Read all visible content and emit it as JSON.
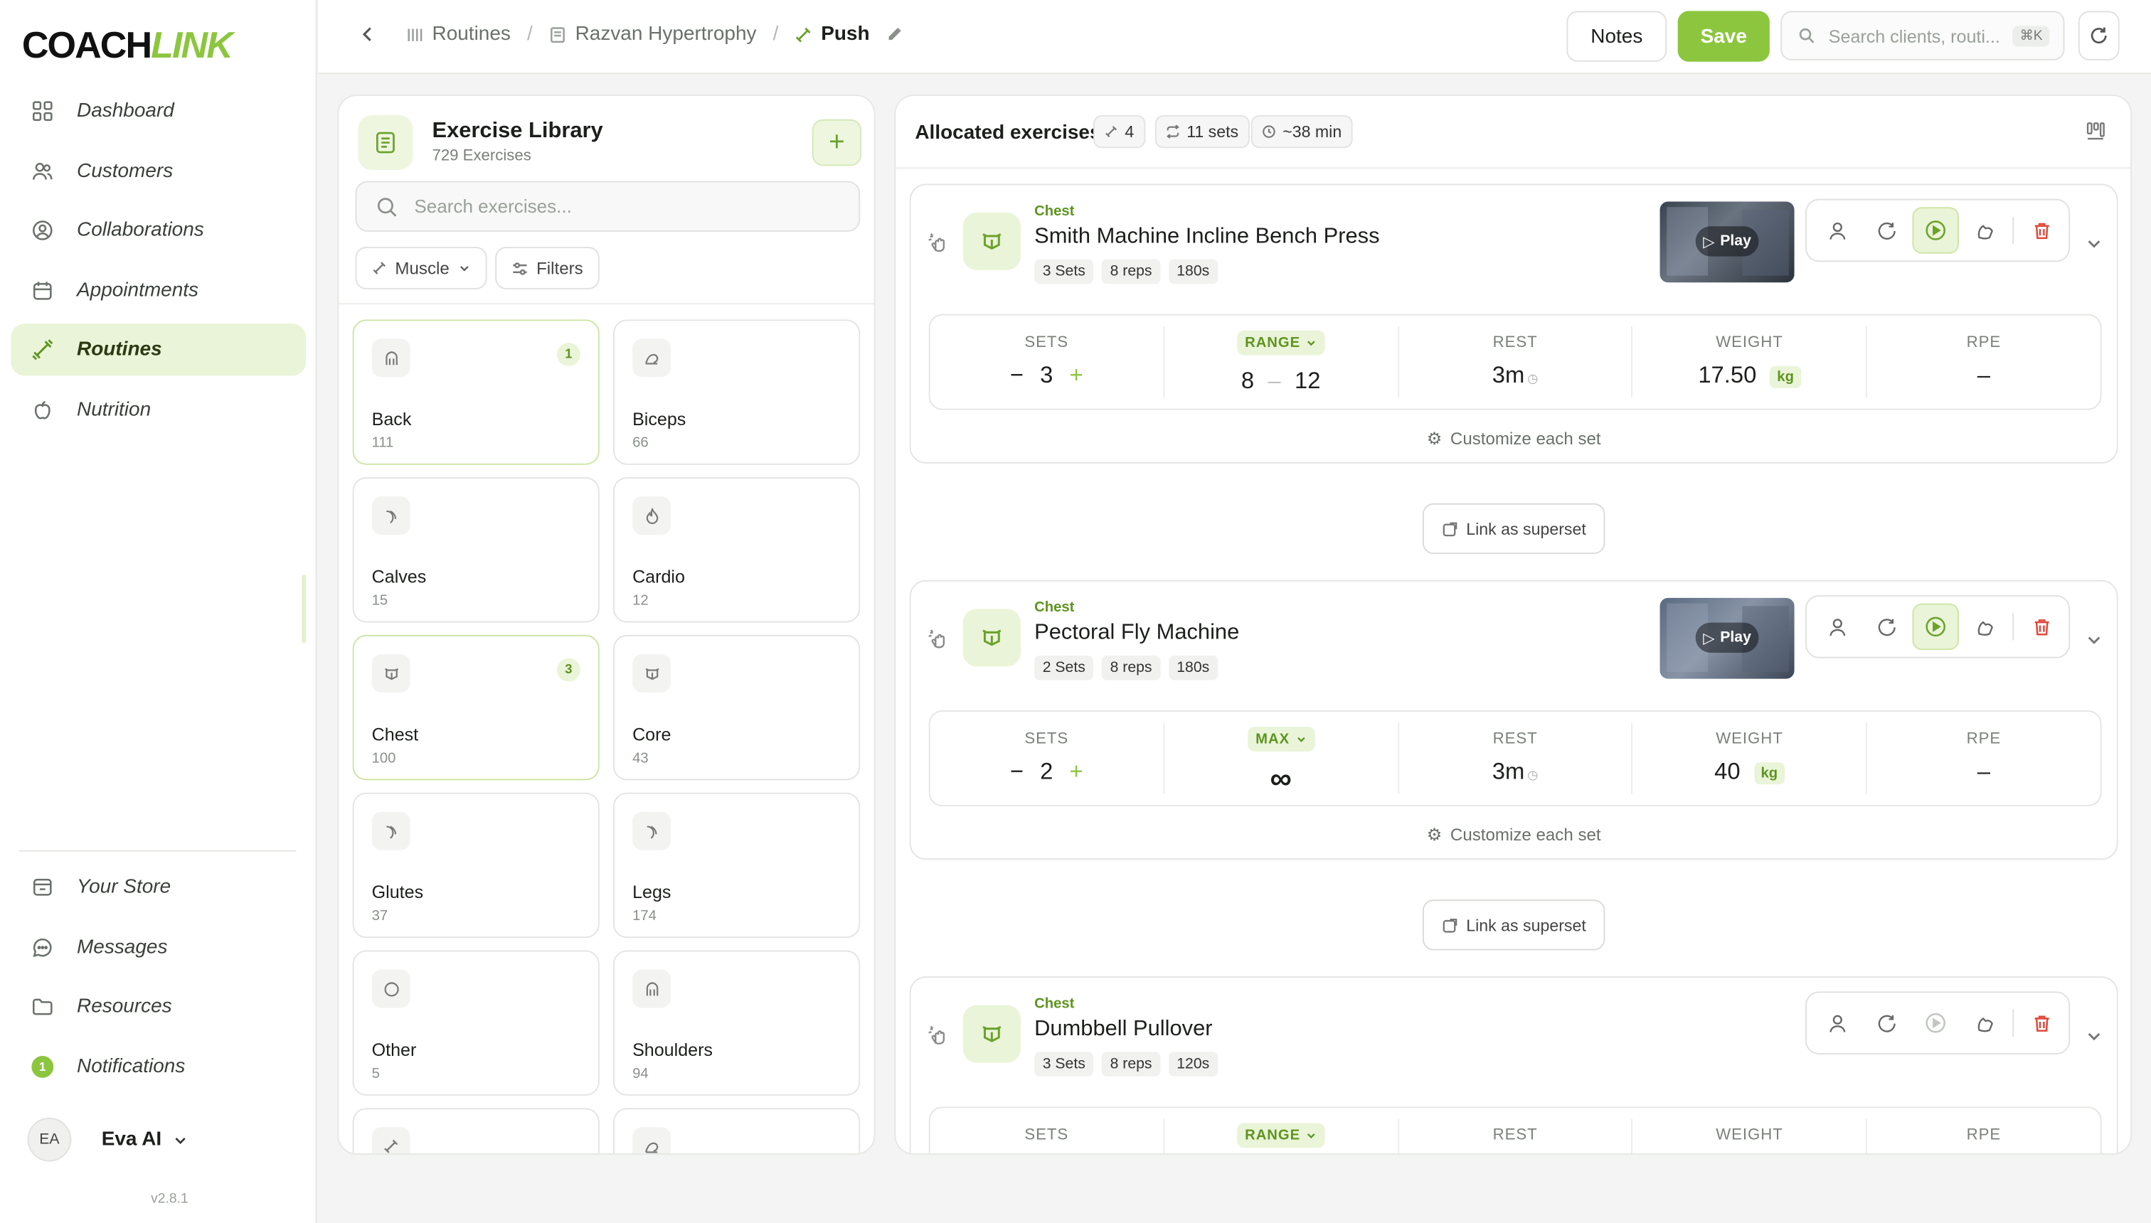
{
  "app": {
    "logo_a": "COACH",
    "logo_b": "LINK",
    "version": "v2.8.1"
  },
  "sidebar": {
    "items": [
      {
        "label": "Dashboard",
        "icon": "grid-icon"
      },
      {
        "label": "Customers",
        "icon": "users-icon"
      },
      {
        "label": "Collaborations",
        "icon": "user-circle-icon"
      },
      {
        "label": "Appointments",
        "icon": "calendar-icon"
      },
      {
        "label": "Routines",
        "icon": "dumbbell-icon",
        "active": true
      },
      {
        "label": "Nutrition",
        "icon": "apple-icon"
      }
    ],
    "bottom_items": [
      {
        "label": "Your Store",
        "icon": "store-icon"
      },
      {
        "label": "Messages",
        "icon": "chat-icon"
      },
      {
        "label": "Resources",
        "icon": "folder-icon"
      },
      {
        "label": "Notifications",
        "icon": "bell-icon",
        "badge": "1"
      }
    ],
    "user": {
      "initials": "EA",
      "name": "Eva AI"
    }
  },
  "topbar": {
    "crumbs": [
      "Routines",
      "Razvan Hypertrophy",
      "Push"
    ],
    "notes_label": "Notes",
    "save_label": "Save",
    "search_placeholder": "Search clients, routi...",
    "search_kbd": "⌘K"
  },
  "library": {
    "title": "Exercise Library",
    "count": "729 Exercises",
    "search_placeholder": "Search exercises...",
    "filter_muscle": "Muscle",
    "filter_filters": "Filters",
    "cards": [
      {
        "name": "Back",
        "count": "111",
        "badge": "1",
        "selected": true
      },
      {
        "name": "Biceps",
        "count": "66"
      },
      {
        "name": "Calves",
        "count": "15"
      },
      {
        "name": "Cardio",
        "count": "12"
      },
      {
        "name": "Chest",
        "count": "100",
        "badge": "3",
        "selected": true
      },
      {
        "name": "Core",
        "count": "43"
      },
      {
        "name": "Glutes",
        "count": "37"
      },
      {
        "name": "Legs",
        "count": "174"
      },
      {
        "name": "Other",
        "count": "5"
      },
      {
        "name": "Shoulders",
        "count": "94"
      }
    ]
  },
  "allocated": {
    "title": "Allocated exercises",
    "stat_exercises": "4",
    "stat_sets": "11 sets",
    "stat_time": "~38 min",
    "labels": {
      "sets": "SETS",
      "rest": "REST",
      "weight": "WEIGHT",
      "rpe": "RPE",
      "customize": "Customize each set",
      "superset": "Link as superset",
      "play": "Play",
      "kg": "kg",
      "dash": "–"
    },
    "exercises": [
      {
        "category": "Chest",
        "name": "Smith Machine Incline Bench Press",
        "tags": [
          "3 Sets",
          "8 reps",
          "180s"
        ],
        "sets": "3",
        "mode": "RANGE",
        "reps_min": "8",
        "reps_max": "12",
        "rest": "3m",
        "weight": "17.50"
      },
      {
        "category": "Chest",
        "name": "Pectoral Fly Machine",
        "tags": [
          "2 Sets",
          "8 reps",
          "180s"
        ],
        "sets": "2",
        "mode": "MAX",
        "reps_symbol": "∞",
        "rest": "3m",
        "weight": "40"
      },
      {
        "category": "Chest",
        "name": "Dumbbell Pullover",
        "tags": [
          "3 Sets",
          "8 reps",
          "120s"
        ],
        "mode": "RANGE"
      }
    ]
  }
}
